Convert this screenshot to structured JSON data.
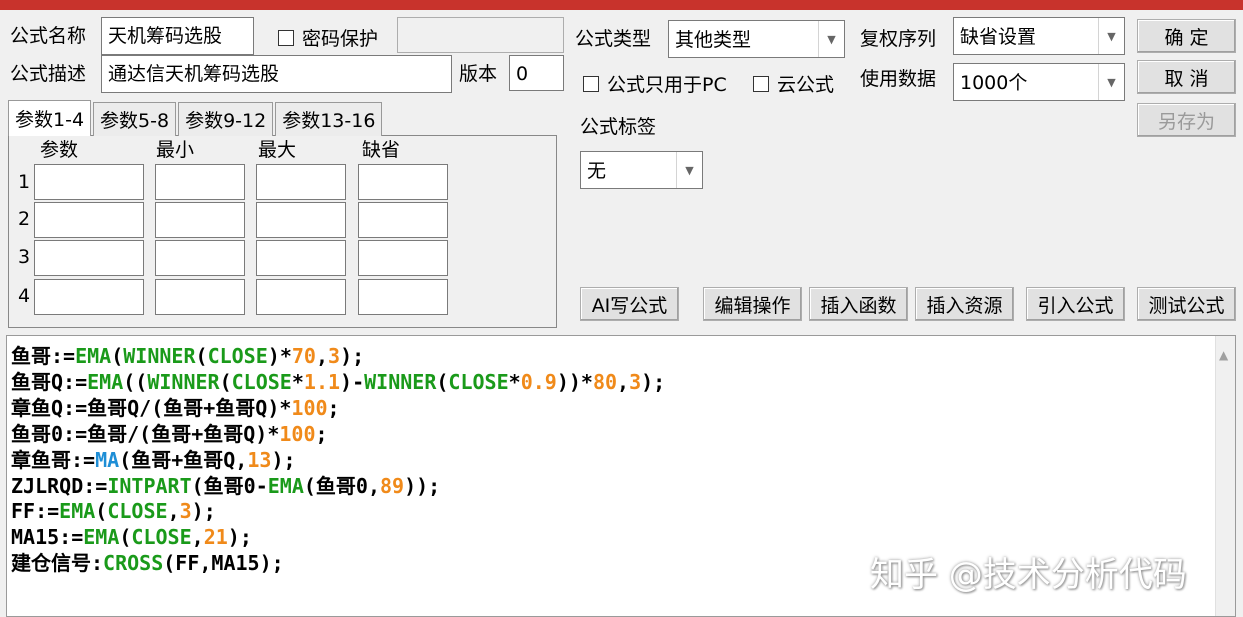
{
  "form": {
    "name_label": "公式名称",
    "name_value": "天机筹码选股",
    "password_label": "密码保护",
    "desc_label": "公式描述",
    "desc_value": "通达信天机筹码选股",
    "version_label": "版本",
    "version_value": "0",
    "type_label": "公式类型",
    "type_value": "其他类型",
    "restore_label": "复权序列",
    "restore_value": "缺省设置",
    "pc_only_label": "公式只用于PC",
    "cloud_label": "云公式",
    "data_label": "使用数据",
    "data_value": "1000个",
    "tag_label": "公式标签",
    "tag_value": "无"
  },
  "buttons": {
    "ok": "确  定",
    "cancel": "取  消",
    "save_as": "另存为",
    "ai": "AI写公式",
    "edit": "编辑操作",
    "insert_func": "插入函数",
    "insert_res": "插入资源",
    "import": "引入公式",
    "test": "测试公式"
  },
  "tabs": [
    "参数1-4",
    "参数5-8",
    "参数9-12",
    "参数13-16"
  ],
  "params": {
    "headers": [
      "参数",
      "最小",
      "最大",
      "缺省"
    ],
    "rows": [
      "1",
      "2",
      "3",
      "4"
    ]
  },
  "code_lines": [
    [
      {
        "t": "鱼哥:=",
        "c": "k"
      },
      {
        "t": "EMA",
        "c": "fn"
      },
      {
        "t": "(",
        "c": "k"
      },
      {
        "t": "WINNER",
        "c": "fn"
      },
      {
        "t": "(",
        "c": "k"
      },
      {
        "t": "CLOSE",
        "c": "fn"
      },
      {
        "t": ")*",
        "c": "k"
      },
      {
        "t": "70",
        "c": "num"
      },
      {
        "t": ",",
        "c": "k"
      },
      {
        "t": "3",
        "c": "num"
      },
      {
        "t": ");",
        "c": "k"
      }
    ],
    [
      {
        "t": "鱼哥Q:=",
        "c": "k"
      },
      {
        "t": "EMA",
        "c": "fn"
      },
      {
        "t": "((",
        "c": "k"
      },
      {
        "t": "WINNER",
        "c": "fn"
      },
      {
        "t": "(",
        "c": "k"
      },
      {
        "t": "CLOSE",
        "c": "fn"
      },
      {
        "t": "*",
        "c": "k"
      },
      {
        "t": "1.1",
        "c": "num"
      },
      {
        "t": ")-",
        "c": "k"
      },
      {
        "t": "WINNER",
        "c": "fn"
      },
      {
        "t": "(",
        "c": "k"
      },
      {
        "t": "CLOSE",
        "c": "fn"
      },
      {
        "t": "*",
        "c": "k"
      },
      {
        "t": "0.9",
        "c": "num"
      },
      {
        "t": "))*",
        "c": "k"
      },
      {
        "t": "80",
        "c": "num"
      },
      {
        "t": ",",
        "c": "k"
      },
      {
        "t": "3",
        "c": "num"
      },
      {
        "t": ");",
        "c": "k"
      }
    ],
    [
      {
        "t": "章鱼Q:=鱼哥Q/(鱼哥+鱼哥Q)*",
        "c": "k"
      },
      {
        "t": "100",
        "c": "num"
      },
      {
        "t": ";",
        "c": "k"
      }
    ],
    [
      {
        "t": "鱼哥0:=鱼哥/(鱼哥+鱼哥Q)*",
        "c": "k"
      },
      {
        "t": "100",
        "c": "num"
      },
      {
        "t": ";",
        "c": "k"
      }
    ],
    [
      {
        "t": "章鱼哥:=",
        "c": "k"
      },
      {
        "t": "MA",
        "c": "fn2"
      },
      {
        "t": "(鱼哥+鱼哥Q,",
        "c": "k"
      },
      {
        "t": "13",
        "c": "num"
      },
      {
        "t": ");",
        "c": "k"
      }
    ],
    [
      {
        "t": "ZJLRQD:=",
        "c": "k"
      },
      {
        "t": "INTPART",
        "c": "fn"
      },
      {
        "t": "(鱼哥0-",
        "c": "k"
      },
      {
        "t": "EMA",
        "c": "fn"
      },
      {
        "t": "(鱼哥0,",
        "c": "k"
      },
      {
        "t": "89",
        "c": "num"
      },
      {
        "t": "));",
        "c": "k"
      }
    ],
    [
      {
        "t": "FF:=",
        "c": "k"
      },
      {
        "t": "EMA",
        "c": "fn"
      },
      {
        "t": "(",
        "c": "k"
      },
      {
        "t": "CLOSE",
        "c": "fn"
      },
      {
        "t": ",",
        "c": "k"
      },
      {
        "t": "3",
        "c": "num"
      },
      {
        "t": ");",
        "c": "k"
      }
    ],
    [
      {
        "t": "MA15:=",
        "c": "k"
      },
      {
        "t": "EMA",
        "c": "fn"
      },
      {
        "t": "(",
        "c": "k"
      },
      {
        "t": "CLOSE",
        "c": "fn"
      },
      {
        "t": ",",
        "c": "k"
      },
      {
        "t": "21",
        "c": "num"
      },
      {
        "t": ");",
        "c": "k"
      }
    ],
    [
      {
        "t": "建仓信号:",
        "c": "k"
      },
      {
        "t": "CROSS",
        "c": "fn"
      },
      {
        "t": "(FF,MA15);",
        "c": "k"
      }
    ]
  ],
  "watermark": "知乎 @技术分析代码",
  "colors": {
    "title_bar": "#c8332c",
    "keyword": "#1a9a1a",
    "keyword_ma": "#1e8ed6",
    "number": "#f08a1a"
  }
}
